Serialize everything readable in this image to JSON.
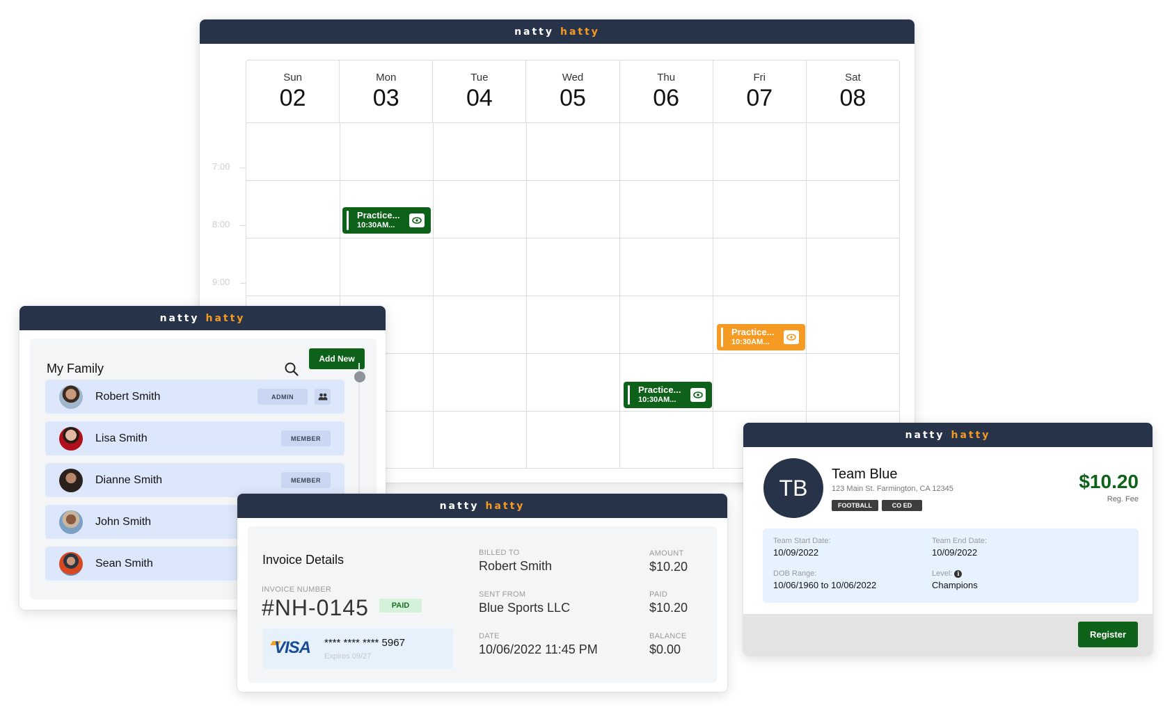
{
  "brand": {
    "part1": "natty",
    "part2": "hatty"
  },
  "colors": {
    "header_bg": "#273349",
    "brand_accent": "#f59a23",
    "green": "#0e6118",
    "orange": "#f59a23"
  },
  "calendar": {
    "days": [
      {
        "dow": "Sun",
        "num": "02"
      },
      {
        "dow": "Mon",
        "num": "03"
      },
      {
        "dow": "Tue",
        "num": "04"
      },
      {
        "dow": "Wed",
        "num": "05"
      },
      {
        "dow": "Thu",
        "num": "06"
      },
      {
        "dow": "Fri",
        "num": "07"
      },
      {
        "dow": "Sat",
        "num": "08"
      }
    ],
    "times": [
      "7:00",
      "8:00",
      "9:00"
    ],
    "events": [
      {
        "title": "Practice...",
        "time": "10:30AM...",
        "day": "Mon",
        "color": "green",
        "icon": "eye-icon"
      },
      {
        "title": "Practice...",
        "time": "10:30AM...",
        "day": "Fri",
        "color": "orange",
        "icon": "eye-icon"
      },
      {
        "title": "Practice...",
        "time": "10:30AM...",
        "day": "Thu",
        "color": "green",
        "icon": "eye-icon"
      }
    ]
  },
  "family": {
    "title": "My Family",
    "search_icon": "search-icon",
    "add_button": "Add New",
    "members": [
      {
        "name": "Robert Smith",
        "role": "ADMIN",
        "has_group_icon": true
      },
      {
        "name": "Lisa Smith",
        "role": "MEMBER"
      },
      {
        "name": "Dianne Smith",
        "role": "MEMBER"
      },
      {
        "name": "John Smith",
        "role": ""
      },
      {
        "name": "Sean Smith",
        "role": ""
      }
    ]
  },
  "invoice": {
    "title": "Invoice Details",
    "number_label": "INVOICE NUMBER",
    "number": "#NH-0145",
    "status": "PAID",
    "card": {
      "brand": "VISA",
      "masked": "**** **** **** 5967",
      "expires": "Expires 09/27"
    },
    "billed_to_label": "BILLED TO",
    "billed_to": "Robert Smith",
    "sent_from_label": "SENT FROM",
    "sent_from": "Blue Sports LLC",
    "date_label": "DATE",
    "date": "10/06/2022 11:45 PM",
    "amount_label": "AMOUNT",
    "amount": "$10.20",
    "paid_label": "PAID",
    "paid": "$10.20",
    "balance_label": "BALANCE",
    "balance": "$0.00"
  },
  "team": {
    "initials": "TB",
    "name": "Team Blue",
    "address": "123 Main St. Farmington, CA 12345",
    "tags": [
      "FOOTBALL",
      "CO ED"
    ],
    "price": "$10.20",
    "price_label": "Reg. Fee",
    "start_label": "Team Start Date:",
    "start": "10/09/2022",
    "end_label": "Team End Date:",
    "end": "10/09/2022",
    "dob_label": "DOB Range:",
    "dob": "10/06/1960 to 10/06/2022",
    "level_label": "Level:",
    "level": "Champions",
    "register_button": "Register"
  }
}
